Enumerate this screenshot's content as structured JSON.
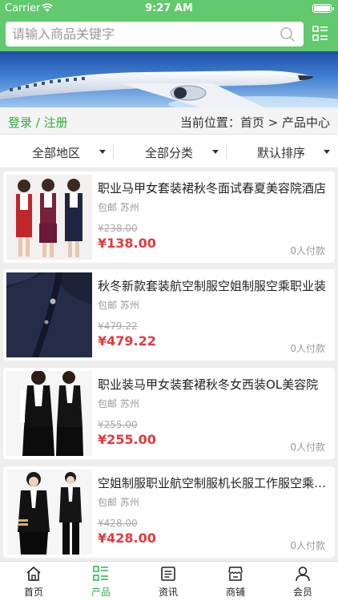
{
  "status": {
    "carrier": "Carrier",
    "time": "9:27 AM"
  },
  "search": {
    "placeholder": "请输入商品关键字"
  },
  "crumb": {
    "login": "登录 / 注册",
    "location": "当前位置：首页 > 产品中心"
  },
  "filters": [
    "全部地区",
    "全部分类",
    "默认排序"
  ],
  "products": [
    {
      "title": "职业马甲女套装裙秋冬面试春夏美容院酒店",
      "shipping": "包邮",
      "city": "苏州",
      "old_price": "¥238.00",
      "price": "¥138.00",
      "sold": "0人付款"
    },
    {
      "title": "秋冬新款套装航空制服空姐制服空乘职业装",
      "shipping": "包邮",
      "city": "苏州",
      "old_price": "¥479.22",
      "price": "¥479.22",
      "sold": "0人付款"
    },
    {
      "title": "职业装马甲女装套裙秋冬女西装OL美容院",
      "shipping": "包邮",
      "city": "苏州",
      "old_price": "¥255.00",
      "price": "¥255.00",
      "sold": "0人付款"
    },
    {
      "title": "空姐制服职业航空制服机长服工作服空乘服装",
      "shipping": "包邮",
      "city": "苏州",
      "old_price": "¥428.00",
      "price": "¥428.00",
      "sold": "0人付款"
    }
  ],
  "tabs": [
    {
      "label": "首页",
      "icon": "home-icon"
    },
    {
      "label": "产品",
      "icon": "grid-list-icon"
    },
    {
      "label": "资讯",
      "icon": "news-icon"
    },
    {
      "label": "商铺",
      "icon": "shop-icon"
    },
    {
      "label": "会员",
      "icon": "user-icon"
    }
  ],
  "colors": {
    "brand": "#62c96e",
    "active_tab": "#2bb24c",
    "price": "#e4393c"
  }
}
